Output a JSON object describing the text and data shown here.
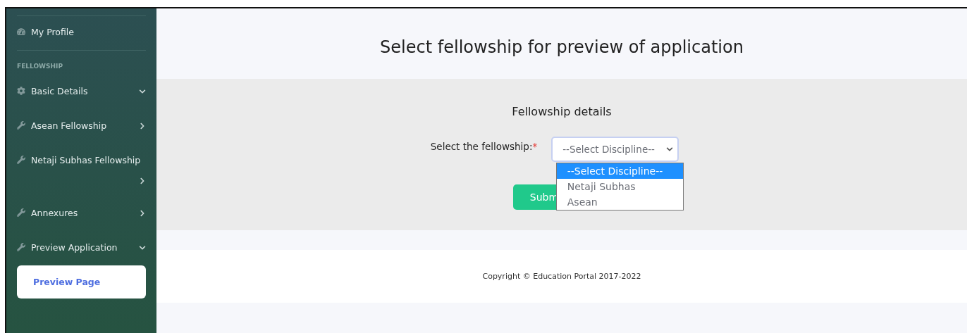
{
  "sidebar": {
    "items": [
      {
        "kind": "link",
        "label": "My Profile"
      },
      {
        "kind": "section",
        "label": "FELLOWSHIP"
      },
      {
        "kind": "settings",
        "label": "Basic Details",
        "expanded": true
      },
      {
        "kind": "tool",
        "label": "Asean Fellowship",
        "expanded": false
      },
      {
        "kind": "tool",
        "label": "Netaji Subhas Fellowship",
        "expanded": false
      },
      {
        "kind": "tool",
        "label": "Annexures",
        "expanded": false
      },
      {
        "kind": "tool",
        "label": "Preview Application",
        "expanded": true,
        "children": [
          {
            "label": "Preview Page",
            "selected": true
          }
        ]
      }
    ]
  },
  "page_title": "Select fellowship for preview of application",
  "form": {
    "heading": "Fellowship details",
    "label": "Select the fellowship:",
    "required_mark": "*",
    "select": {
      "value": "--Select Discipline--",
      "options": [
        {
          "label": "--Select Discipline--",
          "selected": true
        },
        {
          "label": "Netaji Subhas",
          "selected": false
        },
        {
          "label": "Asean",
          "selected": false
        }
      ]
    },
    "submit": "Subm"
  },
  "footer": "Copyright © Education Portal 2017-2022"
}
